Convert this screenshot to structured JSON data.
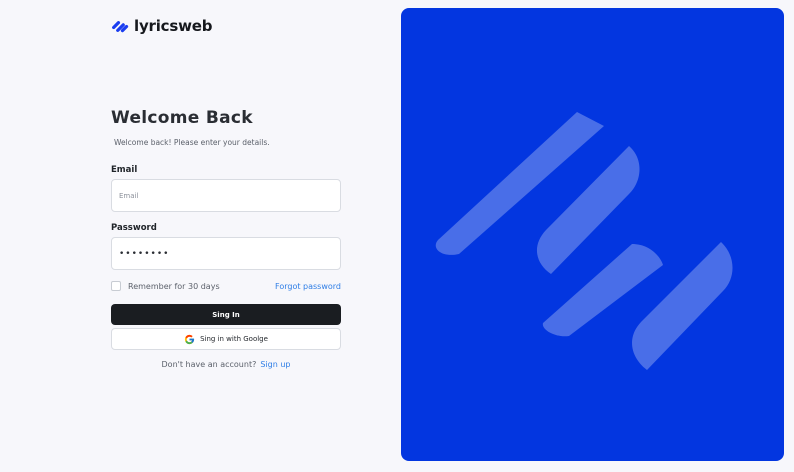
{
  "brand": {
    "name": "lyricsweb"
  },
  "login": {
    "title": "Welcome Back",
    "subtitle": "Welcome back! Please enter your details.",
    "email_label": "Email",
    "email_placeholder": "Email",
    "password_label": "Password",
    "password_value": "••••••••",
    "remember_label": "Remember for 30 days",
    "remember_checked": false,
    "forgot_label": "Forgot password",
    "signin_label": "Sing In",
    "google_label": "Sing in with Goolge",
    "no_account_text": "Don't have an account?",
    "signup_label": "Sign up"
  },
  "colors": {
    "hero_bg": "#0336e0",
    "primary_button": "#1a1d21",
    "link": "#2f7ee6"
  },
  "icons": {
    "logo": "lyricsweb-logo-icon",
    "google": "google-icon",
    "hero_art": "logo-watermark"
  }
}
